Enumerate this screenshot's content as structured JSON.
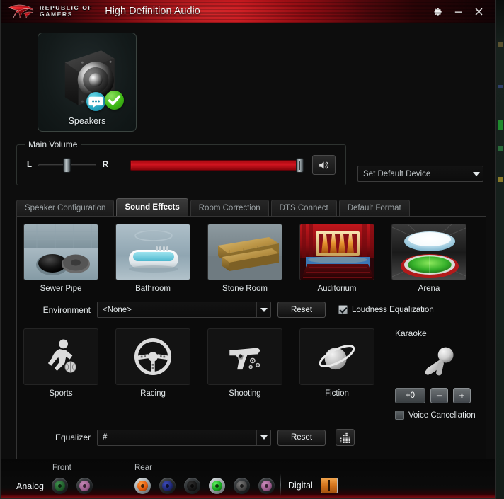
{
  "window": {
    "brand_line1": "REPUBLIC OF",
    "brand_line2": "GAMERS",
    "title": "High Definition Audio",
    "logo_icon": "rog-eye-logo",
    "settings_icon": "gear-icon",
    "minimize_icon": "minimize-icon",
    "close_icon": "close-icon"
  },
  "device": {
    "label": "Speakers",
    "icon": "speaker-box-icon",
    "badges": [
      {
        "name": "chat-badge",
        "icon": "speech-bubble-icon"
      },
      {
        "name": "default-device-badge",
        "icon": "green-check-icon"
      }
    ]
  },
  "main_volume": {
    "legend": "Main Volume",
    "balance_left_label": "L",
    "balance_right_label": "R",
    "balance_percent": 50,
    "volume_percent": 100,
    "mute_icon": "speaker-volume-icon"
  },
  "default_device": {
    "value": "Set Default Device",
    "arrow_icon": "chevron-down-icon"
  },
  "tabs": [
    {
      "label": "Speaker Configuration",
      "active": false
    },
    {
      "label": "Sound Effects",
      "active": true
    },
    {
      "label": "Room Correction",
      "active": false
    },
    {
      "label": "DTS Connect",
      "active": false
    },
    {
      "label": "Default Format",
      "active": false
    }
  ],
  "environments": [
    {
      "label": "Sewer Pipe",
      "icon": "sewer-pipe-thumb",
      "selected": false
    },
    {
      "label": "Bathroom",
      "icon": "bathroom-thumb",
      "selected": false
    },
    {
      "label": "Stone Room",
      "icon": "stone-room-thumb",
      "selected": false
    },
    {
      "label": "Auditorium",
      "icon": "auditorium-thumb",
      "selected": false
    },
    {
      "label": "Arena",
      "icon": "arena-thumb",
      "selected": false
    }
  ],
  "environment_row": {
    "label": "Environment",
    "value": "<None>",
    "reset_label": "Reset",
    "loudness_label": "Loudness Equalization",
    "loudness_checked": true
  },
  "eq_presets": [
    {
      "label": "Sports",
      "icon": "basketball-player-icon"
    },
    {
      "label": "Racing",
      "icon": "steering-wheel-icon"
    },
    {
      "label": "Shooting",
      "icon": "pistol-icon"
    },
    {
      "label": "Fiction",
      "icon": "planet-saturn-icon"
    }
  ],
  "karaoke": {
    "title": "Karaoke",
    "icon": "microphone-icon",
    "pitch_value": "+0",
    "decrement_label": "−",
    "increment_label": "+",
    "voice_cancellation_label": "Voice Cancellation",
    "voice_cancellation_checked": false
  },
  "equalizer_row": {
    "label": "Equalizer",
    "value": "#",
    "reset_label": "Reset",
    "bars_icon": "equalizer-bars-icon"
  },
  "connectors": {
    "analog_label": "Analog",
    "front_label": "Front",
    "rear_label": "Rear",
    "digital_label": "Digital",
    "spdif_icon": "spdif-optical-icon",
    "front_jacks": [
      {
        "name": "front-green-jack",
        "color": "#1f5e2a",
        "active": false
      },
      {
        "name": "front-pink-jack",
        "color": "#9c5e8e",
        "active": false
      }
    ],
    "rear_jacks": [
      {
        "name": "rear-orange-jack",
        "color": "#e35a0c",
        "active": true
      },
      {
        "name": "rear-blue-jack",
        "color": "#202a78",
        "active": false
      },
      {
        "name": "rear-black-jack",
        "color": "#161616",
        "active": false
      },
      {
        "name": "rear-green-jack",
        "color": "#17a81f",
        "active": true
      },
      {
        "name": "rear-grey-jack",
        "color": "#4a4a4a",
        "active": false
      },
      {
        "name": "rear-pink-jack",
        "color": "#a05f92",
        "active": false
      }
    ]
  },
  "theme": {
    "accent_red": "#b5121a",
    "panel_bg": "#0b0b0b",
    "window_bg": "#0d0d0d",
    "text_primary": "#e4e9eb",
    "text_muted": "#9aa1a4"
  }
}
